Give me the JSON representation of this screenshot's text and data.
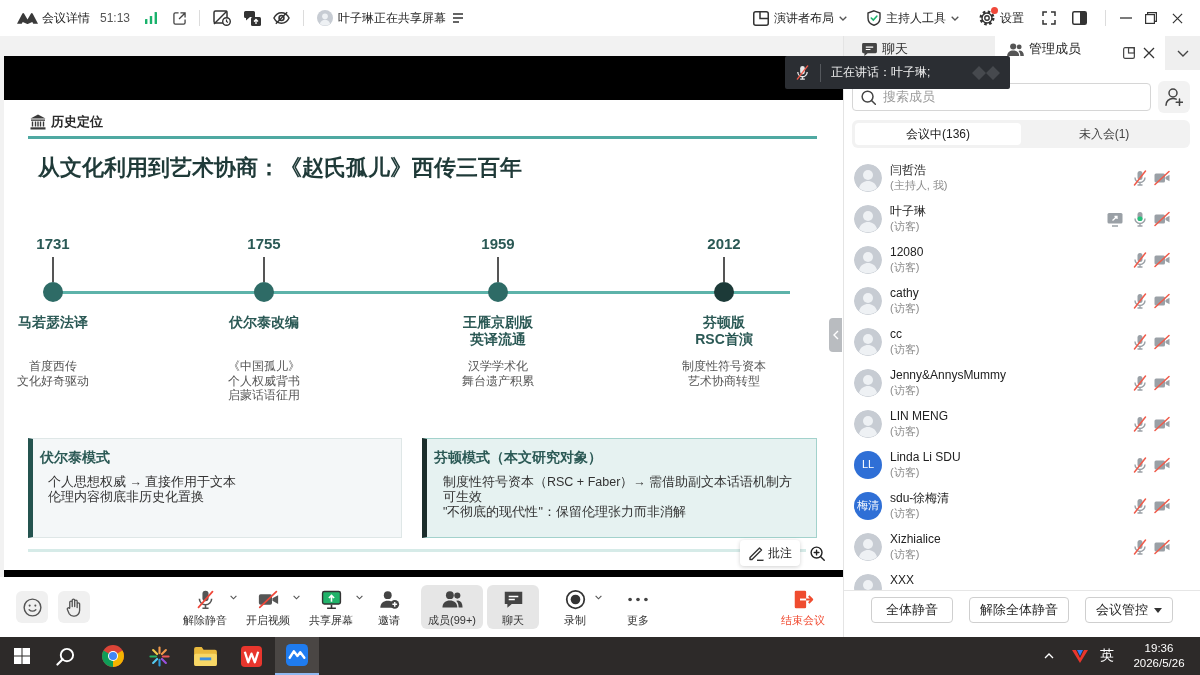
{
  "window": {
    "title": "会议详情",
    "duration": "51:13",
    "share_notice": "叶子琳正在共享屏幕"
  },
  "top_actions": [
    {
      "kind": "layout",
      "label": "演讲者布局",
      "dropdown": true,
      "badge": false
    },
    {
      "kind": "host",
      "label": "主持人工具",
      "dropdown": true,
      "badge": false
    },
    {
      "kind": "settings",
      "label": "设置",
      "dropdown": false,
      "badge": true
    }
  ],
  "speaker_overlay": {
    "label": "正在讲话：叶子琳;",
    "mic_on": false
  },
  "slide": {
    "section": "历史定位",
    "title": "从文化利用到艺术协商：《赵氏孤儿》西传三百年",
    "events": [
      {
        "year": "1731",
        "title": [
          "马若瑟法译"
        ],
        "description": [
          "首度西传",
          "文化好奇驱动"
        ],
        "highlighted": false
      },
      {
        "year": "1755",
        "title": [
          "伏尔泰改编"
        ],
        "description": [
          "《中国孤儿》",
          "个人权威背书",
          "启蒙话语征用"
        ],
        "highlighted": false
      },
      {
        "year": "1959",
        "title": [
          "王雁京剧版",
          "英译流通"
        ],
        "description": [
          "汉学学术化",
          "舞台遗产积累"
        ],
        "highlighted": false
      },
      {
        "year": "2012",
        "title": [
          "芬顿版",
          "RSC首演"
        ],
        "description": [
          "制度性符号资本",
          "艺术协商转型"
        ],
        "highlighted": true
      }
    ],
    "panels": [
      {
        "title": "伏尔泰模式",
        "lines": [
          "个人思想权威 → 直接作用于文本",
          "伦理内容彻底非历史化置换"
        ],
        "highlighted": false
      },
      {
        "title": "芬顿模式（本文研究对象）",
        "lines": [
          "制度性符号资本（RSC + Faber）→ 需借助副文本话语机制方可生效",
          "\"不彻底的现代性\"：保留伦理张力而非消解"
        ],
        "highlighted": true
      }
    ]
  },
  "annotate_button": {
    "label": "批注"
  },
  "meeting_toolbar": {
    "items": [
      {
        "kind": "unmute",
        "label": "解除静音",
        "dropdown": true,
        "selected": false
      },
      {
        "kind": "camera",
        "label": "开启视频",
        "dropdown": true,
        "selected": false
      },
      {
        "kind": "share",
        "label": "共享屏幕",
        "dropdown": true,
        "selected": false
      },
      {
        "kind": "invite",
        "label": "邀请",
        "dropdown": false,
        "selected": false
      },
      {
        "kind": "members",
        "label": "成员(99+)",
        "dropdown": false,
        "selected": true
      },
      {
        "kind": "chat",
        "label": "聊天",
        "dropdown": false,
        "selected": true
      },
      {
        "kind": "record",
        "label": "录制",
        "dropdown": true,
        "selected": false
      },
      {
        "kind": "more",
        "label": "更多",
        "dropdown": false,
        "selected": false
      }
    ],
    "end_button": {
      "label": "结束会议"
    }
  },
  "side_panel": {
    "tabs": [
      {
        "label": "聊天",
        "selected": false
      },
      {
        "label": "管理成员",
        "selected": true
      }
    ],
    "search": {
      "placeholder": "搜索成员"
    },
    "segments": [
      {
        "label": "会议中(136)",
        "selected": true
      },
      {
        "label": "未入会(1)",
        "selected": false
      }
    ],
    "members": [
      {
        "name": "闫哲浩",
        "role": "(主持人, 我)",
        "sharing": false,
        "mic_on": false,
        "video_on": false
      },
      {
        "name": "叶子琳",
        "role": "(访客)",
        "sharing": true,
        "mic_on": true,
        "video_on": false
      },
      {
        "name": "12080",
        "role": "(访客)",
        "sharing": false,
        "mic_on": false,
        "video_on": false
      },
      {
        "name": "cathy",
        "role": "(访客)",
        "sharing": false,
        "mic_on": false,
        "video_on": false
      },
      {
        "name": "cc",
        "role": "(访客)",
        "sharing": false,
        "mic_on": false,
        "video_on": false
      },
      {
        "name": "Jenny&AnnysMummy",
        "role": "(访客)",
        "sharing": false,
        "mic_on": false,
        "video_on": false
      },
      {
        "name": "LIN MENG",
        "role": "(访客)",
        "sharing": false,
        "mic_on": false,
        "video_on": false
      },
      {
        "name": "Linda Li SDU",
        "initials": "LL",
        "role": "(访客)",
        "sharing": false,
        "mic_on": false,
        "video_on": false
      },
      {
        "name": "sdu-徐梅清",
        "initials": "梅清",
        "role": "(访客)",
        "sharing": false,
        "mic_on": false,
        "video_on": false
      },
      {
        "name": "Xizhialice",
        "role": "(访客)",
        "sharing": false,
        "mic_on": false,
        "video_on": false
      },
      {
        "name": "XXX"
      }
    ],
    "actions": [
      {
        "label": "全体静音",
        "dropdown": false
      },
      {
        "label": "解除全体静音",
        "dropdown": false
      },
      {
        "label": "会议管控",
        "dropdown": true
      }
    ]
  },
  "taskbar": {
    "apps": [
      {
        "kind": "browser",
        "selected": false
      },
      {
        "kind": "sunburst",
        "selected": false
      },
      {
        "kind": "folder",
        "selected": false
      },
      {
        "kind": "writer",
        "selected": false
      },
      {
        "kind": "meeting",
        "selected": true
      }
    ],
    "ime": "英",
    "time": "19:36",
    "date": "2026/5/26"
  }
}
